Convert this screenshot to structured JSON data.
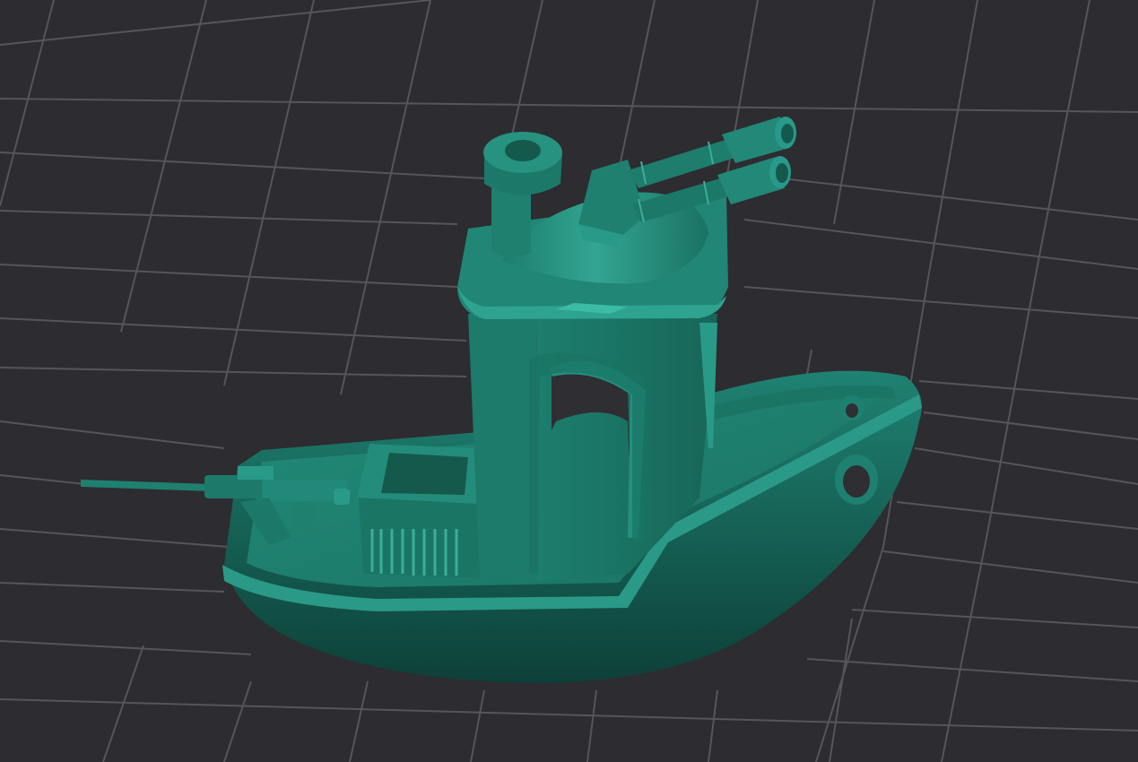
{
  "viewport": {
    "background": "#2d2c30",
    "grid_color": "#55545a",
    "model_color": "#1f7d6e",
    "model_highlight": "#2a9c8a",
    "model_shadow": "#0f4a40",
    "model_name": "",
    "parts": [
      "hull",
      "cabin",
      "chimney",
      "gatling-turret",
      "bow-machine-gun",
      "ammo-crate",
      "porthole"
    ]
  }
}
